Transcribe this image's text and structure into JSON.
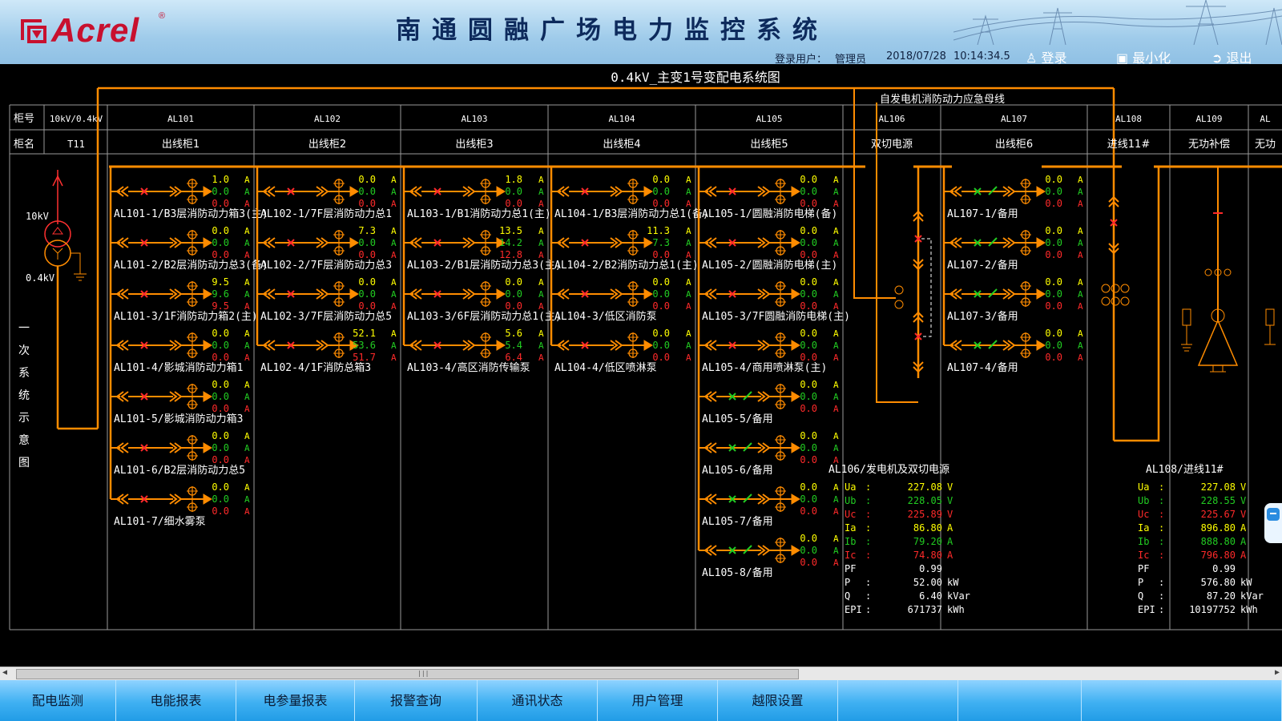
{
  "header": {
    "logo_text": "Acrel",
    "logo_reg": "®",
    "app_title": "南通圆融广场电力监控系统",
    "login_user_label": "登录用户：",
    "login_user": "管理员",
    "date": "2018/07/28",
    "time": "10:14:34.5",
    "btn_login": "登录",
    "btn_minimize": "最小化",
    "btn_exit": "退出"
  },
  "diagram": {
    "title": "0.4kV_主变1号变配电系统图",
    "bus_label": "自发电机消防动力应急母线",
    "row_label_no": "柜号",
    "row_label_name": "柜名",
    "transformer": {
      "cabinet_no": "10kV/0.4kV",
      "cabinet_name": "T11",
      "hv": "10kV",
      "lv": "0.4kV",
      "side_text": [
        "一",
        "次",
        "系",
        "统",
        "示",
        "意",
        "图"
      ]
    },
    "columns": [
      {
        "no": "AL101",
        "name": "出线柜1",
        "feeders": [
          {
            "label": "AL101-1/B3层消防动力箱3(主)",
            "a": "1.0",
            "b": "0.0",
            "c": "0.0"
          },
          {
            "label": "AL101-2/B2层消防动力总3(备)",
            "a": "0.0",
            "b": "0.0",
            "c": "0.0"
          },
          {
            "label": "AL101-3/1F消防动力箱2(主)",
            "a": "9.5",
            "b": "9.6",
            "c": "9.5"
          },
          {
            "label": "AL101-4/影城消防动力箱1",
            "a": "0.0",
            "b": "0.0",
            "c": "0.0"
          },
          {
            "label": "AL101-5/影城消防动力箱3",
            "a": "0.0",
            "b": "0.0",
            "c": "0.0"
          },
          {
            "label": "AL101-6/B2层消防动力总5",
            "a": "0.0",
            "b": "0.0",
            "c": "0.0"
          },
          {
            "label": "AL101-7/细水雾泵",
            "a": "0.0",
            "b": "0.0",
            "c": "0.0"
          }
        ]
      },
      {
        "no": "AL102",
        "name": "出线柜2",
        "feeders": [
          {
            "label": "AL102-1/7F层消防动力总1",
            "a": "0.0",
            "b": "0.0",
            "c": "0.0"
          },
          {
            "label": "AL102-2/7F层消防动力总3",
            "a": "7.3",
            "b": "0.0",
            "c": "0.0"
          },
          {
            "label": "AL102-3/7F层消防动力总5",
            "a": "0.0",
            "b": "0.0",
            "c": "0.0"
          },
          {
            "label": "AL102-4/1F消防总箱3",
            "a": "52.1",
            "b": "53.6",
            "c": "51.7"
          }
        ]
      },
      {
        "no": "AL103",
        "name": "出线柜3",
        "feeders": [
          {
            "label": "AL103-1/B1消防动力总1(主)",
            "a": "1.8",
            "b": "0.0",
            "c": "0.0"
          },
          {
            "label": "AL103-2/B1层消防动力总3(主)",
            "a": "13.5",
            "b": "14.2",
            "c": "12.8"
          },
          {
            "label": "AL103-3/6F层消防动力总1(主)",
            "a": "0.0",
            "b": "0.0",
            "c": "0.0"
          },
          {
            "label": "AL103-4/高区消防传输泵",
            "a": "5.6",
            "b": "5.4",
            "c": "6.4"
          }
        ]
      },
      {
        "no": "AL104",
        "name": "出线柜4",
        "feeders": [
          {
            "label": "AL104-1/B3层消防动力总1(备)",
            "a": "0.0",
            "b": "0.0",
            "c": "0.0"
          },
          {
            "label": "AL104-2/B2消防动力总1(主)",
            "a": "11.3",
            "b": "7.3",
            "c": "0.0"
          },
          {
            "label": "AL104-3/低区消防泵",
            "a": "0.0",
            "b": "0.0",
            "c": "0.0"
          },
          {
            "label": "AL104-4/低区喷淋泵",
            "a": "0.0",
            "b": "0.0",
            "c": "0.0"
          }
        ]
      },
      {
        "no": "AL105",
        "name": "出线柜5",
        "feeders": [
          {
            "label": "AL105-1/圆融消防电梯(备)",
            "a": "0.0",
            "b": "0.0",
            "c": "0.0"
          },
          {
            "label": "AL105-2/圆融消防电梯(主)",
            "a": "0.0",
            "b": "0.0",
            "c": "0.0"
          },
          {
            "label": "AL105-3/7F圆融消防电梯(主)",
            "a": "0.0",
            "b": "0.0",
            "c": "0.0"
          },
          {
            "label": "AL105-4/商用喷淋泵(主)",
            "a": "0.0",
            "b": "0.0",
            "c": "0.0"
          },
          {
            "label": "AL105-5/备用",
            "a": "0.0",
            "b": "0.0",
            "c": "0.0"
          },
          {
            "label": "AL105-6/备用",
            "a": "0.0",
            "b": "0.0",
            "c": "0.0"
          },
          {
            "label": "AL105-7/备用",
            "a": "0.0",
            "b": "0.0",
            "c": "0.0"
          },
          {
            "label": "AL105-8/备用",
            "a": "0.0",
            "b": "0.0",
            "c": "0.0"
          }
        ]
      },
      {
        "no": "AL106",
        "name": "双切电源",
        "feeders": []
      },
      {
        "no": "AL107",
        "name": "出线柜6",
        "feeders": [
          {
            "label": "AL107-1/备用",
            "a": "0.0",
            "b": "0.0",
            "c": "0.0"
          },
          {
            "label": "AL107-2/备用",
            "a": "0.0",
            "b": "0.0",
            "c": "0.0"
          },
          {
            "label": "AL107-3/备用",
            "a": "0.0",
            "b": "0.0",
            "c": "0.0"
          },
          {
            "label": "AL107-4/备用",
            "a": "0.0",
            "b": "0.0",
            "c": "0.0"
          }
        ]
      },
      {
        "no": "AL108",
        "name": "进线11#",
        "feeders": []
      },
      {
        "no": "AL109",
        "name": "无功补偿",
        "feeders": []
      },
      {
        "no": "AL",
        "name": "无功",
        "feeders": []
      }
    ],
    "unit_a": "A",
    "meters": [
      {
        "title": "AL106/发电机及双切电源",
        "rows": [
          {
            "k": "Ua",
            "sep": ":",
            "v": "227.08",
            "u": "V",
            "color": "#ffff00"
          },
          {
            "k": "Ub",
            "sep": ":",
            "v": "228.05",
            "u": "V",
            "color": "#22cc22"
          },
          {
            "k": "Uc",
            "sep": ":",
            "v": "225.89",
            "u": "V",
            "color": "#ff2a2a"
          },
          {
            "k": "Ia",
            "sep": ":",
            "v": "86.80",
            "u": "A",
            "color": "#ffff00"
          },
          {
            "k": "Ib",
            "sep": ":",
            "v": "79.20",
            "u": "A",
            "color": "#22cc22"
          },
          {
            "k": "Ic",
            "sep": ":",
            "v": "74.80",
            "u": "A",
            "color": "#ff2a2a"
          },
          {
            "k": "PF",
            "sep": "",
            "v": "0.99",
            "u": "",
            "color": "#ffffff"
          },
          {
            "k": "P",
            "sep": ":",
            "v": "52.00",
            "u": "kW",
            "color": "#ffffff"
          },
          {
            "k": "Q",
            "sep": ":",
            "v": "6.40",
            "u": "kVar",
            "color": "#ffffff"
          },
          {
            "k": "EPI",
            "sep": ":",
            "v": "671737",
            "u": "kWh",
            "color": "#ffffff"
          }
        ]
      },
      {
        "title": "AL108/进线11#",
        "rows": [
          {
            "k": "Ua",
            "sep": ":",
            "v": "227.08",
            "u": "V",
            "color": "#ffff00"
          },
          {
            "k": "Ub",
            "sep": ":",
            "v": "228.55",
            "u": "V",
            "color": "#22cc22"
          },
          {
            "k": "Uc",
            "sep": ":",
            "v": "225.67",
            "u": "V",
            "color": "#ff2a2a"
          },
          {
            "k": "Ia",
            "sep": ":",
            "v": "896.80",
            "u": "A",
            "color": "#ffff00"
          },
          {
            "k": "Ib",
            "sep": ":",
            "v": "888.80",
            "u": "A",
            "color": "#22cc22"
          },
          {
            "k": "Ic",
            "sep": ":",
            "v": "796.80",
            "u": "A",
            "color": "#ff2a2a"
          },
          {
            "k": "PF",
            "sep": "",
            "v": "0.99",
            "u": "",
            "color": "#ffffff"
          },
          {
            "k": "P",
            "sep": ":",
            "v": "576.80",
            "u": "kW",
            "color": "#ffffff"
          },
          {
            "k": "Q",
            "sep": ":",
            "v": "87.20",
            "u": "kVar",
            "color": "#ffffff"
          },
          {
            "k": "EPI",
            "sep": ":",
            "v": "10197752",
            "u": "kWh",
            "color": "#ffffff"
          }
        ]
      }
    ],
    "colors": {
      "bus": "#ff8c00",
      "phase_a": "#ffff00",
      "phase_b": "#22cc22",
      "phase_c": "#ff2a2a",
      "breaker_closed": "#ff2a2a",
      "breaker_open": "#22cc22",
      "grid": "#c8c8c8"
    }
  },
  "nav": [
    "配电监测",
    "电能报表",
    "电参量报表",
    "报警查询",
    "通讯状态",
    "用户管理",
    "越限设置",
    "",
    "",
    ""
  ]
}
